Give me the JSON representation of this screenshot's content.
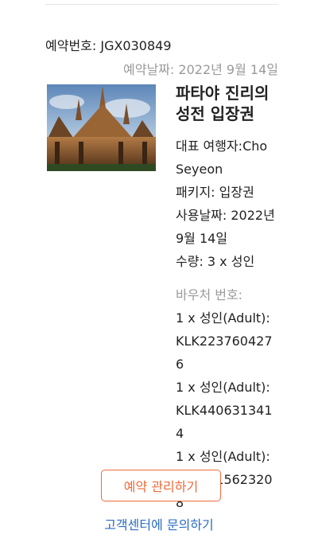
{
  "booking": {
    "number_text": "예약번호: JGX030849",
    "date_text": "예약날짜: 2022년 9월 14일"
  },
  "product": {
    "title": "파타야 진리의 성전 입장권",
    "lead_traveler": "대표 여행자:Cho Seyeon",
    "package": "패키지: 입장권",
    "use_date": "사용날짜: 2022년 9월 14일",
    "quantity": "수량: 3 x 성인"
  },
  "voucher": {
    "label": "바우처 번호:",
    "items": [
      {
        "type": "1 x 성인(Adult):",
        "code": "KLK2237604276"
      },
      {
        "type": "1 x 성인(Adult):",
        "code": "KLK4406313414"
      },
      {
        "type": "1 x 성인(Adult):",
        "code": "KLK5615623208"
      }
    ]
  },
  "actions": {
    "manage_label": "예약 관리하기",
    "contact_label": "고객센터에 문의하기"
  },
  "colors": {
    "accent": "#f06a3a",
    "link": "#2b6cc4",
    "muted": "#9a9a9a"
  }
}
